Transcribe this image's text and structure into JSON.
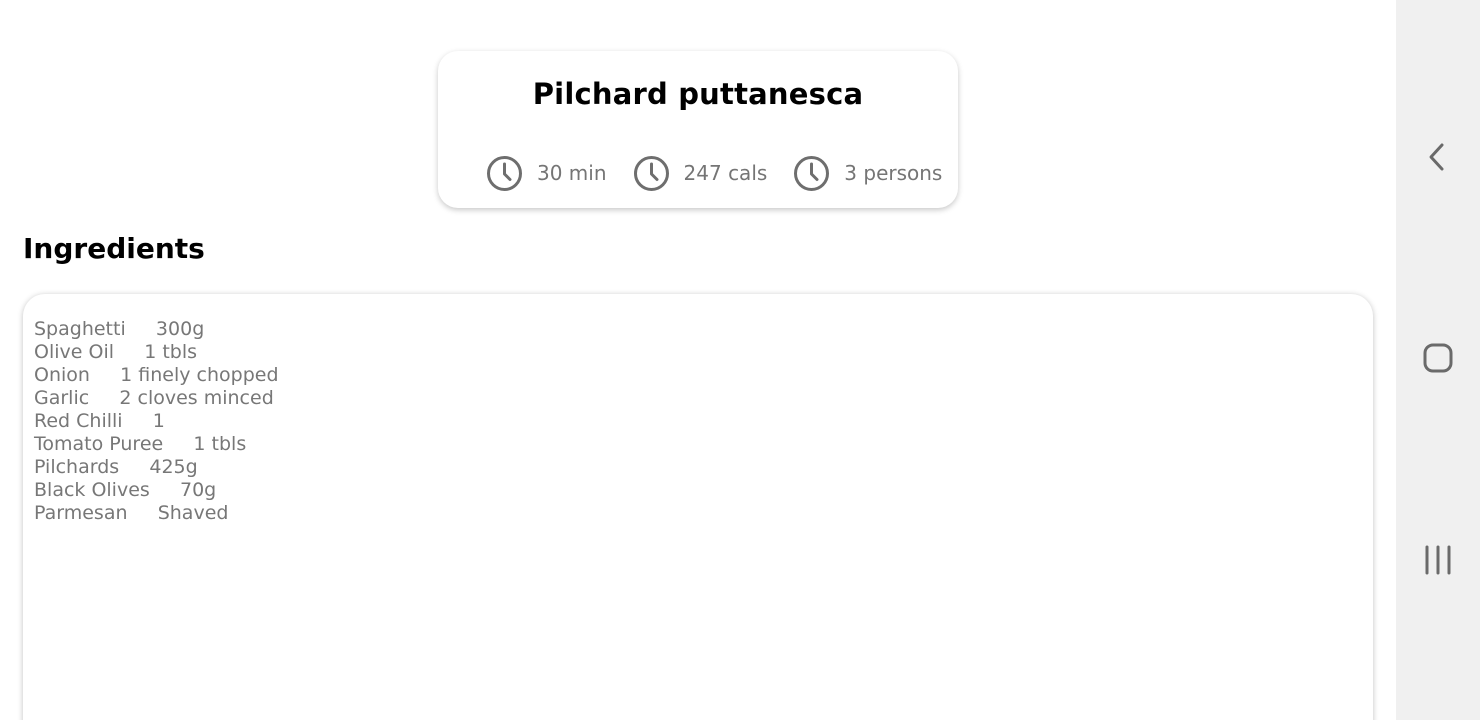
{
  "recipe": {
    "title": "Pilchard puttanesca",
    "meta": [
      {
        "icon": "clock-icon",
        "text": "30 min"
      },
      {
        "icon": "clock-icon",
        "text": "247 cals"
      },
      {
        "icon": "clock-icon",
        "text": "3 persons"
      }
    ]
  },
  "ingredients": {
    "heading": "Ingredients",
    "items": [
      {
        "name": "Spaghetti",
        "amount": "300g"
      },
      {
        "name": "Olive Oil",
        "amount": "1 tbls"
      },
      {
        "name": "Onion",
        "amount": "1 finely chopped"
      },
      {
        "name": "Garlic",
        "amount": "2 cloves minced"
      },
      {
        "name": "Red Chilli",
        "amount": "1"
      },
      {
        "name": "Tomato Puree",
        "amount": "1 tbls"
      },
      {
        "name": "Pilchards",
        "amount": "425g"
      },
      {
        "name": "Black Olives",
        "amount": "70g"
      },
      {
        "name": "Parmesan",
        "amount": "Shaved"
      }
    ],
    "lines": [
      "Spaghetti     300g",
      "Olive Oil     1 tbls",
      "Onion     1 finely chopped",
      "Garlic     2 cloves minced",
      "Red Chilli     1",
      "Tomato Puree     1 tbls",
      "Pilchards     425g",
      "Black Olives     70g",
      "Parmesan     Shaved"
    ]
  },
  "navigation": {
    "buttons": [
      "back-icon",
      "home-icon",
      "recents-icon"
    ]
  },
  "colors": {
    "text_primary": "#000000",
    "text_secondary": "#777777",
    "nav_background": "#f0f0f0",
    "icon_gray": "#757575"
  }
}
